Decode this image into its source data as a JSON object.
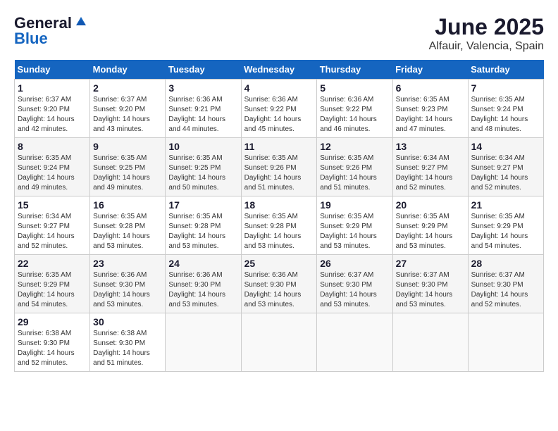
{
  "header": {
    "logo_general": "General",
    "logo_blue": "Blue",
    "month_title": "June 2025",
    "subtitle": "Alfauir, Valencia, Spain"
  },
  "weekdays": [
    "Sunday",
    "Monday",
    "Tuesday",
    "Wednesday",
    "Thursday",
    "Friday",
    "Saturday"
  ],
  "weeks": [
    [
      {
        "day": "1",
        "sunrise": "6:37 AM",
        "sunset": "9:20 PM",
        "daylight": "14 hours and 42 minutes."
      },
      {
        "day": "2",
        "sunrise": "6:37 AM",
        "sunset": "9:20 PM",
        "daylight": "14 hours and 43 minutes."
      },
      {
        "day": "3",
        "sunrise": "6:36 AM",
        "sunset": "9:21 PM",
        "daylight": "14 hours and 44 minutes."
      },
      {
        "day": "4",
        "sunrise": "6:36 AM",
        "sunset": "9:22 PM",
        "daylight": "14 hours and 45 minutes."
      },
      {
        "day": "5",
        "sunrise": "6:36 AM",
        "sunset": "9:22 PM",
        "daylight": "14 hours and 46 minutes."
      },
      {
        "day": "6",
        "sunrise": "6:35 AM",
        "sunset": "9:23 PM",
        "daylight": "14 hours and 47 minutes."
      },
      {
        "day": "7",
        "sunrise": "6:35 AM",
        "sunset": "9:24 PM",
        "daylight": "14 hours and 48 minutes."
      }
    ],
    [
      {
        "day": "8",
        "sunrise": "6:35 AM",
        "sunset": "9:24 PM",
        "daylight": "14 hours and 49 minutes."
      },
      {
        "day": "9",
        "sunrise": "6:35 AM",
        "sunset": "9:25 PM",
        "daylight": "14 hours and 49 minutes."
      },
      {
        "day": "10",
        "sunrise": "6:35 AM",
        "sunset": "9:25 PM",
        "daylight": "14 hours and 50 minutes."
      },
      {
        "day": "11",
        "sunrise": "6:35 AM",
        "sunset": "9:26 PM",
        "daylight": "14 hours and 51 minutes."
      },
      {
        "day": "12",
        "sunrise": "6:35 AM",
        "sunset": "9:26 PM",
        "daylight": "14 hours and 51 minutes."
      },
      {
        "day": "13",
        "sunrise": "6:34 AM",
        "sunset": "9:27 PM",
        "daylight": "14 hours and 52 minutes."
      },
      {
        "day": "14",
        "sunrise": "6:34 AM",
        "sunset": "9:27 PM",
        "daylight": "14 hours and 52 minutes."
      }
    ],
    [
      {
        "day": "15",
        "sunrise": "6:34 AM",
        "sunset": "9:27 PM",
        "daylight": "14 hours and 52 minutes."
      },
      {
        "day": "16",
        "sunrise": "6:35 AM",
        "sunset": "9:28 PM",
        "daylight": "14 hours and 53 minutes."
      },
      {
        "day": "17",
        "sunrise": "6:35 AM",
        "sunset": "9:28 PM",
        "daylight": "14 hours and 53 minutes."
      },
      {
        "day": "18",
        "sunrise": "6:35 AM",
        "sunset": "9:28 PM",
        "daylight": "14 hours and 53 minutes."
      },
      {
        "day": "19",
        "sunrise": "6:35 AM",
        "sunset": "9:29 PM",
        "daylight": "14 hours and 53 minutes."
      },
      {
        "day": "20",
        "sunrise": "6:35 AM",
        "sunset": "9:29 PM",
        "daylight": "14 hours and 53 minutes."
      },
      {
        "day": "21",
        "sunrise": "6:35 AM",
        "sunset": "9:29 PM",
        "daylight": "14 hours and 54 minutes."
      }
    ],
    [
      {
        "day": "22",
        "sunrise": "6:35 AM",
        "sunset": "9:29 PM",
        "daylight": "14 hours and 54 minutes."
      },
      {
        "day": "23",
        "sunrise": "6:36 AM",
        "sunset": "9:30 PM",
        "daylight": "14 hours and 53 minutes."
      },
      {
        "day": "24",
        "sunrise": "6:36 AM",
        "sunset": "9:30 PM",
        "daylight": "14 hours and 53 minutes."
      },
      {
        "day": "25",
        "sunrise": "6:36 AM",
        "sunset": "9:30 PM",
        "daylight": "14 hours and 53 minutes."
      },
      {
        "day": "26",
        "sunrise": "6:37 AM",
        "sunset": "9:30 PM",
        "daylight": "14 hours and 53 minutes."
      },
      {
        "day": "27",
        "sunrise": "6:37 AM",
        "sunset": "9:30 PM",
        "daylight": "14 hours and 53 minutes."
      },
      {
        "day": "28",
        "sunrise": "6:37 AM",
        "sunset": "9:30 PM",
        "daylight": "14 hours and 52 minutes."
      }
    ],
    [
      {
        "day": "29",
        "sunrise": "6:38 AM",
        "sunset": "9:30 PM",
        "daylight": "14 hours and 52 minutes."
      },
      {
        "day": "30",
        "sunrise": "6:38 AM",
        "sunset": "9:30 PM",
        "daylight": "14 hours and 51 minutes."
      },
      null,
      null,
      null,
      null,
      null
    ]
  ]
}
